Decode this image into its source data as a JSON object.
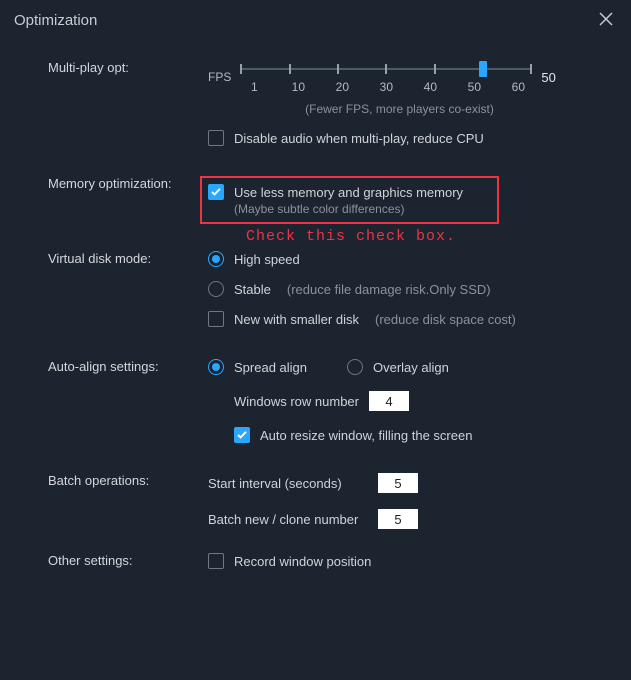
{
  "titlebar": {
    "title": "Optimization"
  },
  "multiplay": {
    "label": "Multi-play opt:",
    "fps_label": "FPS",
    "ticks": [
      "1",
      "10",
      "20",
      "30",
      "40",
      "50",
      "60"
    ],
    "value_label": "50",
    "hint": "(Fewer FPS, more players co-exist)",
    "disable_audio": "Disable audio when multi-play, reduce CPU"
  },
  "memory": {
    "label": "Memory optimization:",
    "useless": "Use less memory and graphics memory",
    "useless_hint": "(Maybe subtle color differences)"
  },
  "annotation": "Check this check box.",
  "vdisk": {
    "label": "Virtual disk mode:",
    "high": "High speed",
    "stable": "Stable",
    "stable_desc": "(reduce file damage risk.Only SSD)",
    "newdisk": "New with smaller disk",
    "newdisk_desc": "(reduce disk space cost)"
  },
  "align": {
    "label": "Auto-align settings:",
    "spread": "Spread align",
    "overlay": "Overlay align",
    "rownum_label": "Windows row number",
    "rownum_value": "4",
    "auto_resize": "Auto resize window, filling the screen"
  },
  "batch": {
    "label": "Batch operations:",
    "start_label": "Start interval (seconds)",
    "start_value": "5",
    "clone_label": "Batch new / clone number",
    "clone_value": "5"
  },
  "other": {
    "label": "Other settings:",
    "record": "Record window position"
  }
}
